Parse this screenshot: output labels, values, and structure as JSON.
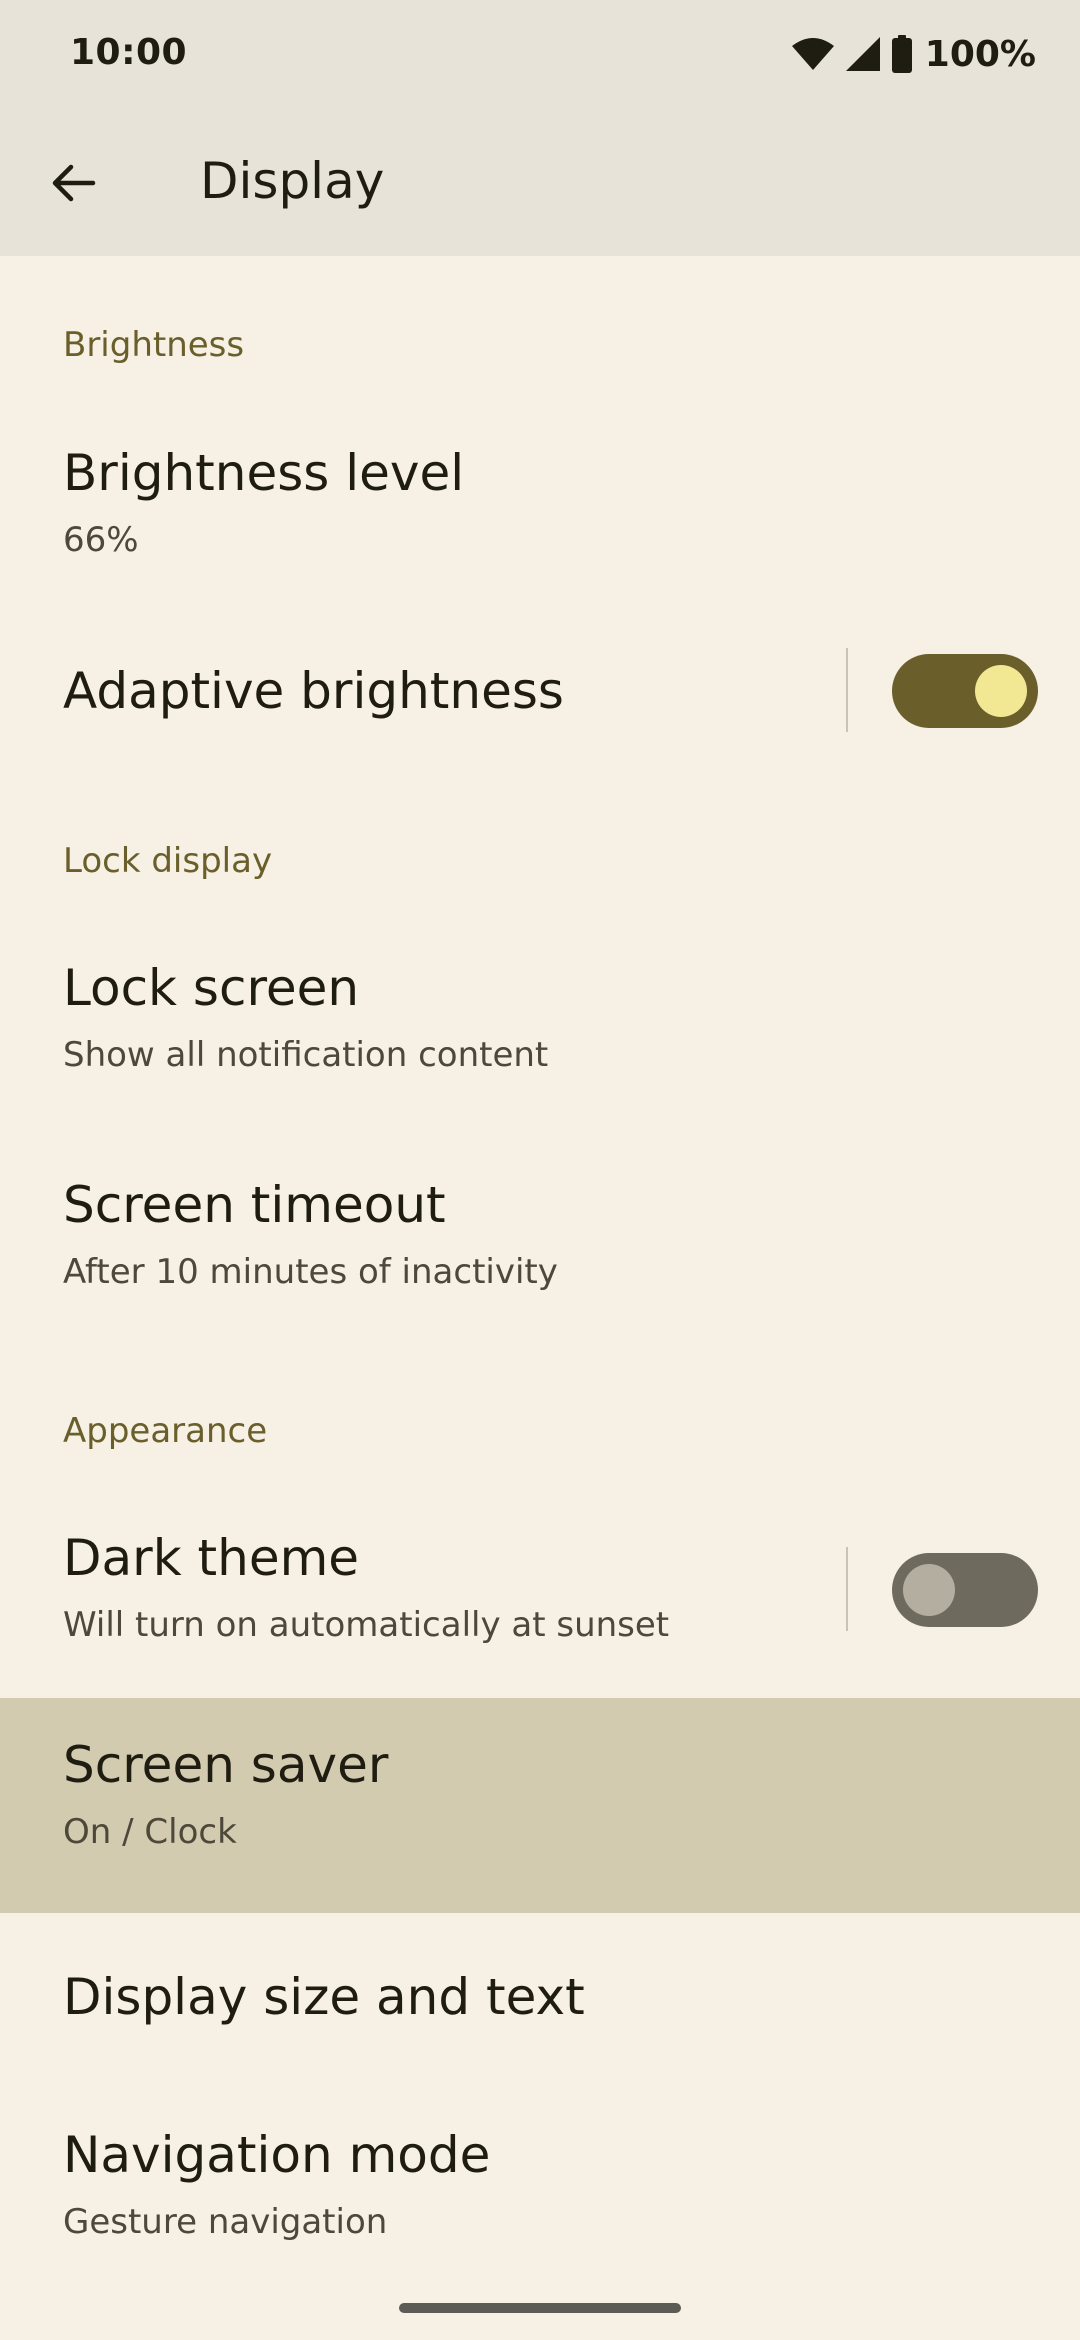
{
  "status_bar": {
    "time": "10:00",
    "battery": "100%",
    "icons": [
      "wifi-icon",
      "signal-icon",
      "battery-icon"
    ]
  },
  "app_bar": {
    "title": "Display",
    "back_icon": "arrow-back-icon"
  },
  "sections": {
    "brightness": "Brightness",
    "lock_display": "Lock display",
    "appearance": "Appearance"
  },
  "items": {
    "brightness_level": {
      "title": "Brightness level",
      "subtitle": "66%"
    },
    "adaptive_brightness": {
      "title": "Adaptive brightness",
      "enabled": true
    },
    "lock_screen": {
      "title": "Lock screen",
      "subtitle": "Show all notification content"
    },
    "screen_timeout": {
      "title": "Screen timeout",
      "subtitle": "After 10 minutes of inactivity"
    },
    "dark_theme": {
      "title": "Dark theme",
      "subtitle": "Will turn on automatically at sunset",
      "enabled": false
    },
    "screen_saver": {
      "title": "Screen saver",
      "subtitle": "On / Clock"
    },
    "display_size": {
      "title": "Display size and text"
    },
    "navigation_mode": {
      "title": "Navigation mode",
      "subtitle": "Gesture navigation"
    }
  },
  "colors": {
    "background": "#f6f0e5",
    "header_background": "#e8e3d8",
    "accent": "#6a5f2b",
    "highlight": "#d3cbb0",
    "switch_on_knob": "#f2e793",
    "switch_off_track": "#6e6b5e"
  }
}
